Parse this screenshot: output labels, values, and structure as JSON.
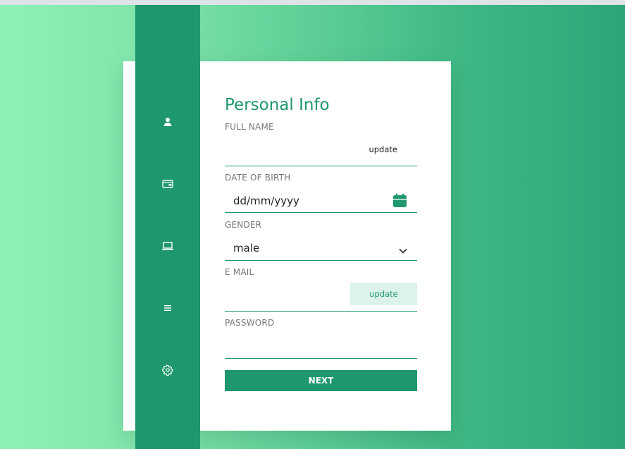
{
  "form": {
    "title": "Personal Info",
    "full_name": {
      "label": "FULL NAME",
      "value": "",
      "action": "update"
    },
    "date_of_birth": {
      "label": "DATE OF BIRTH",
      "value": "dd/mm/yyyy"
    },
    "gender": {
      "label": "GENDER",
      "selected": "male"
    },
    "email": {
      "label": "E MAIL",
      "value": "",
      "action": "update"
    },
    "password": {
      "label": "PASSWORD",
      "value": ""
    },
    "next_label": "NEXT"
  },
  "sidebar": {
    "items": [
      {
        "icon": "user-icon"
      },
      {
        "icon": "wallet-icon"
      },
      {
        "icon": "laptop-icon"
      },
      {
        "icon": "menu-icon"
      },
      {
        "icon": "gear-icon"
      }
    ]
  },
  "colors": {
    "accent": "#1e976c",
    "accent_tint": "#dcf3e9",
    "background_start": "#8ef2b7",
    "background_end": "#2ba778"
  }
}
